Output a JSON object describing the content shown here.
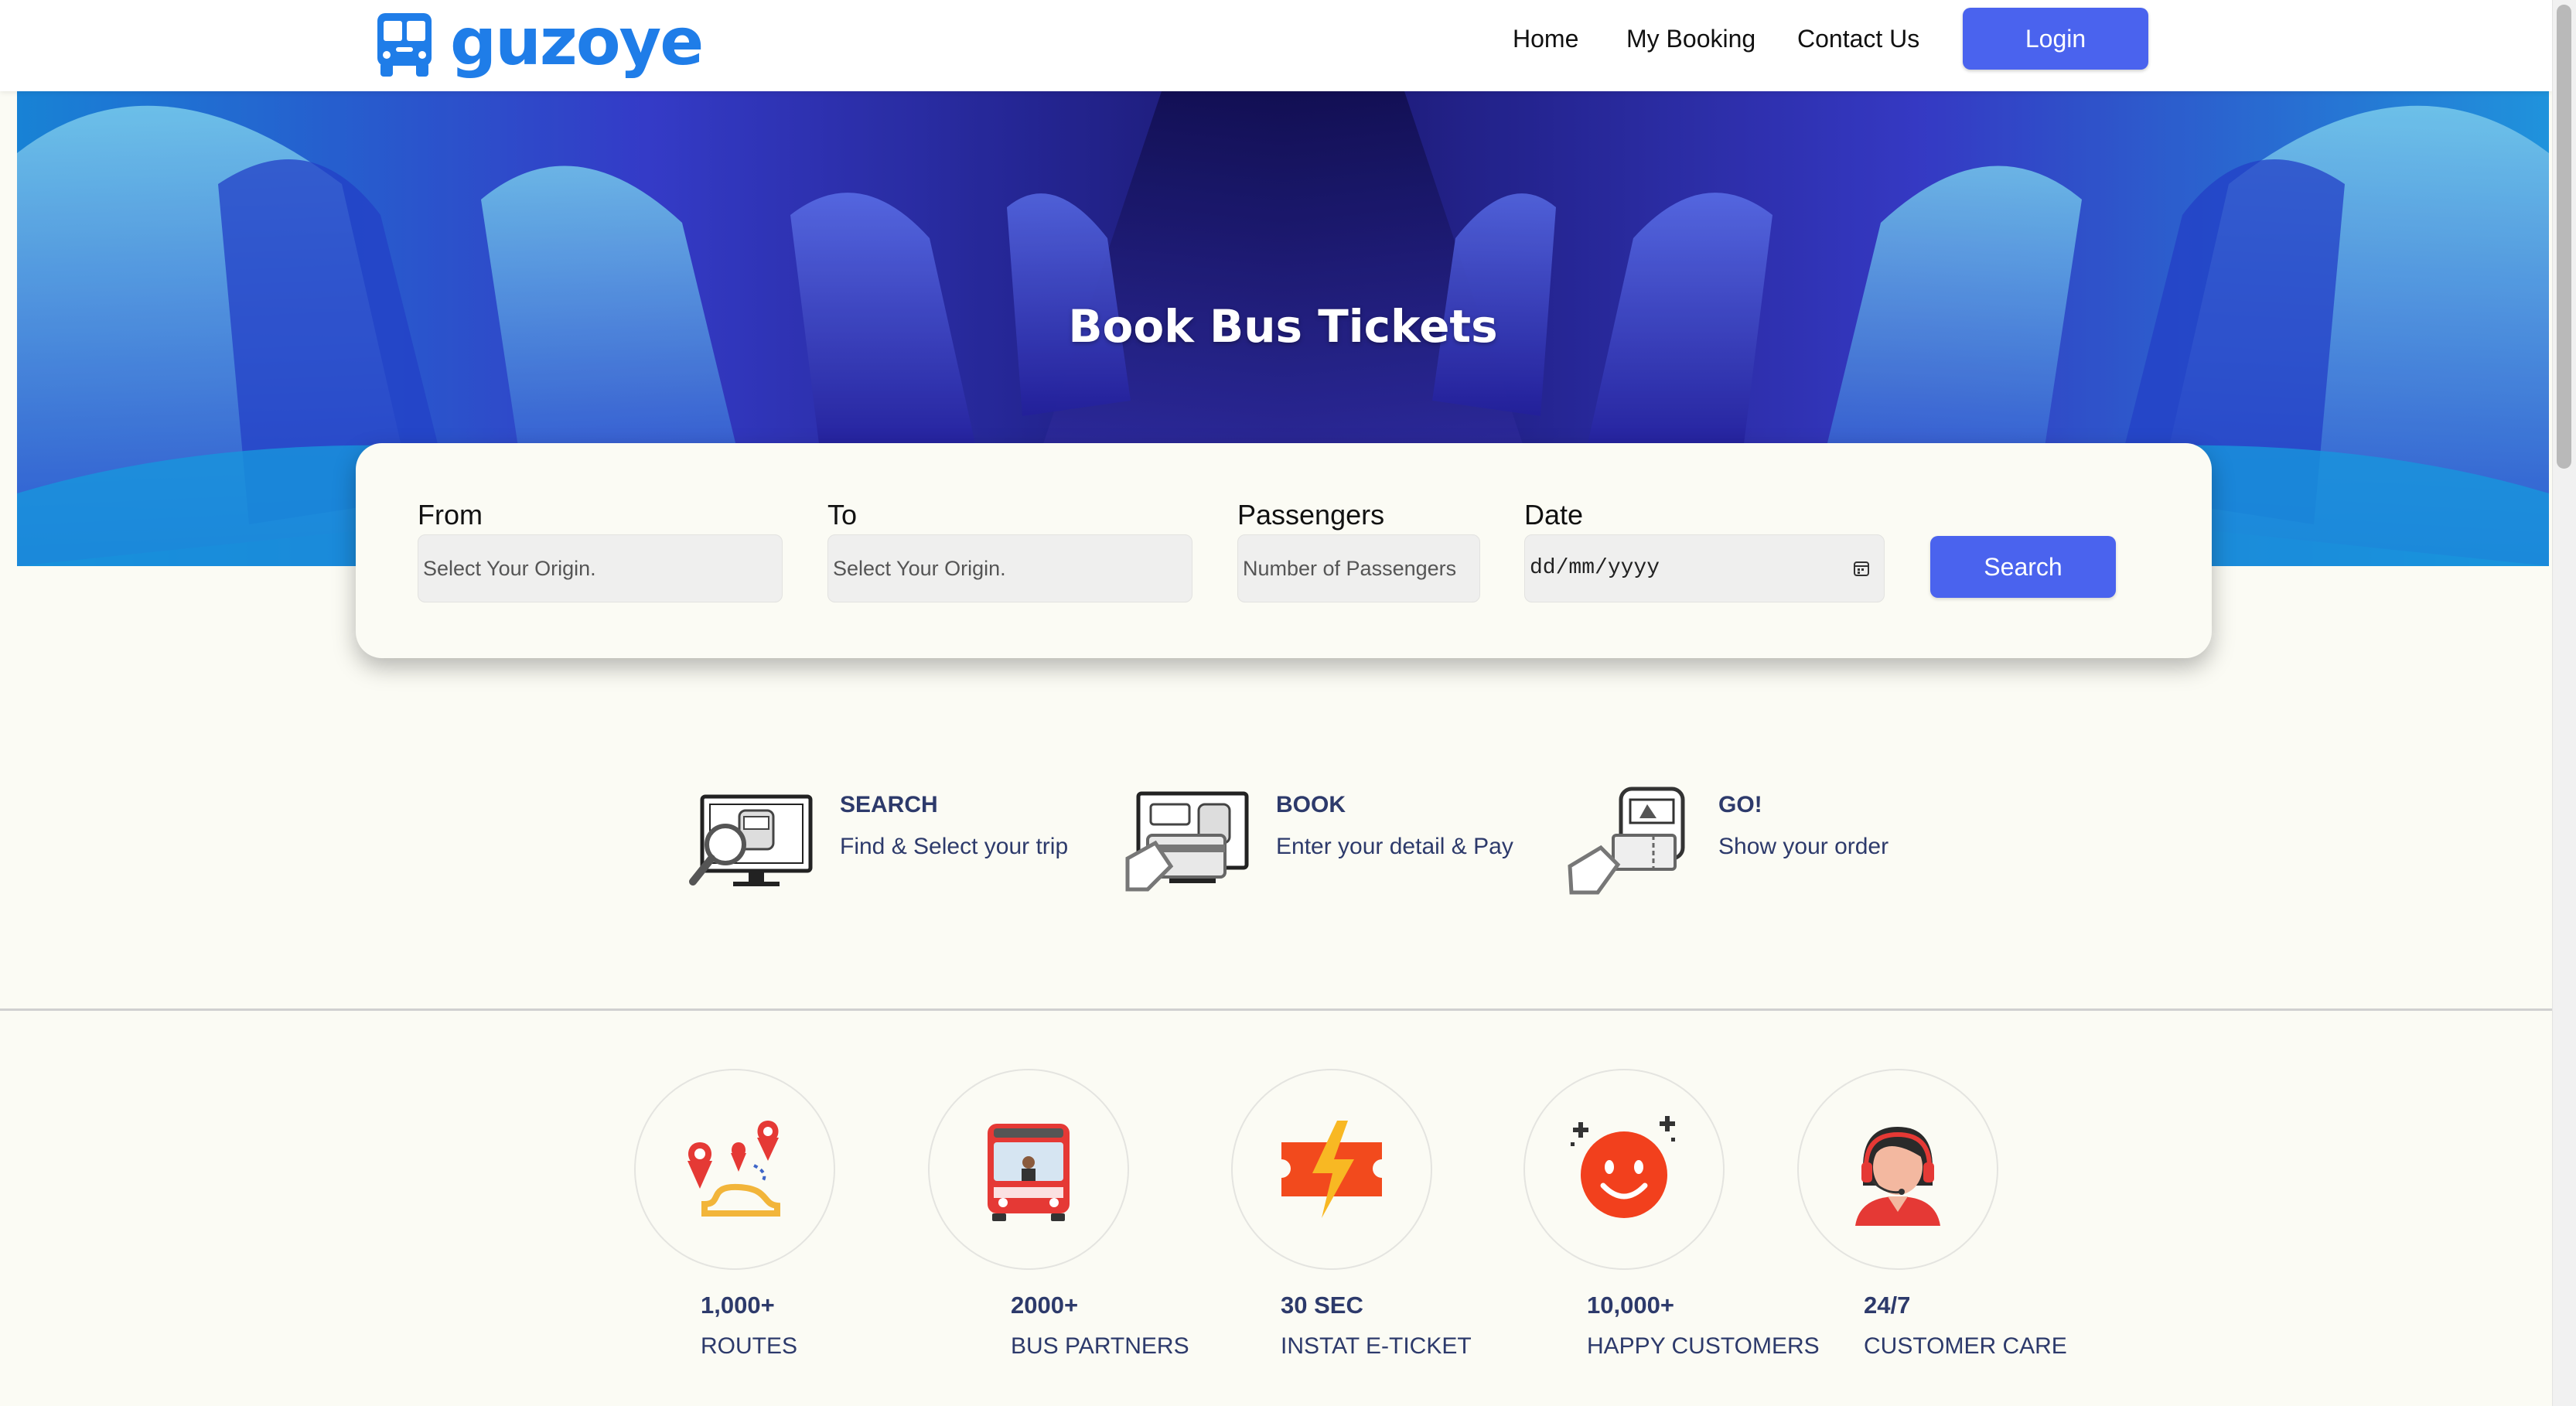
{
  "brand": {
    "name": "guzoye",
    "icon": "bus-icon",
    "color": "#1f7de8"
  },
  "nav": {
    "links": [
      "Home",
      "My Booking",
      "Contact Us"
    ],
    "login_label": "Login",
    "accent": "#4a63ee"
  },
  "hero": {
    "title": "Book Bus Tickets"
  },
  "search_form": {
    "from": {
      "label": "From",
      "placeholder": "Select Your Origin."
    },
    "to": {
      "label": "To",
      "placeholder": "Select Your Origin."
    },
    "passengers": {
      "label": "Passengers",
      "placeholder": "Number of Passengers"
    },
    "date": {
      "label": "Date",
      "value": "dd/mm/yyyy",
      "icon": "calendar-icon"
    },
    "search_label": "Search"
  },
  "steps": [
    {
      "title": "SEARCH",
      "desc": "Find & Select your trip",
      "icon": "search-bus-monitor-icon"
    },
    {
      "title": "BOOK",
      "desc": "Enter your detail & Pay",
      "icon": "book-pay-card-icon"
    },
    {
      "title": "GO!",
      "desc": "Show your order",
      "icon": "ticket-hand-icon"
    }
  ],
  "stats": [
    {
      "value": "1,000+",
      "label": "ROUTES",
      "icon": "route-map-pins-icon"
    },
    {
      "value": "2000+",
      "label": "BUS PARTNERS",
      "icon": "red-bus-icon"
    },
    {
      "value": "30 SEC",
      "label": "INSTAT E-TICKET",
      "icon": "lightning-ticket-icon"
    },
    {
      "value": "10,000+",
      "label": "HAPPY CUSTOMERS",
      "icon": "smiley-face-icon"
    },
    {
      "value": "24/7",
      "label": "CUSTOMER CARE",
      "icon": "support-agent-icon"
    }
  ]
}
